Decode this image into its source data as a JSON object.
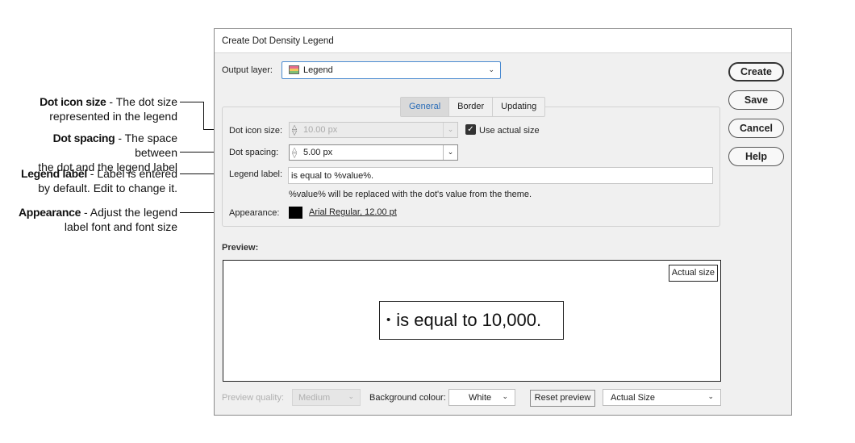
{
  "callouts": [
    {
      "bold": "Dot icon size",
      "text1": " - The dot size",
      "text2": "represented in the legend"
    },
    {
      "bold": "Dot spacing",
      "text1": " - The space between",
      "text2": "the dot and the legend label"
    },
    {
      "bold": "Legend label",
      "text1": " - Label is entered",
      "text2": "by default. Edit to change it."
    },
    {
      "bold": "Appearance",
      "text1": " - Adjust the legend",
      "text2": "label font and font size"
    }
  ],
  "dialog": {
    "title": "Create Dot Density Legend",
    "output_layer_label": "Output layer:",
    "output_layer_value": "Legend",
    "buttons": {
      "create": "Create",
      "save": "Save",
      "cancel": "Cancel",
      "help": "Help"
    },
    "tabs": [
      {
        "label": "General",
        "active": true
      },
      {
        "label": "Border",
        "active": false
      },
      {
        "label": "Updating",
        "active": false
      }
    ],
    "general": {
      "dot_icon_size_label": "Dot icon size:",
      "dot_icon_size_value": "10.00 px",
      "dot_icon_size_enabled": false,
      "use_actual_size_label": "Use actual size",
      "use_actual_size_checked": true,
      "dot_spacing_label": "Dot spacing:",
      "dot_spacing_value": "5.00 px",
      "legend_label_label": "Legend label:",
      "legend_label_value": "is equal to %value%.",
      "legend_hint": "%value% will be replaced with the dot's value from the theme.",
      "appearance_label": "Appearance:",
      "appearance_swatch_color": "#000000",
      "appearance_font": "Arial Regular, 12.00 pt"
    },
    "preview": {
      "title": "Preview:",
      "actual_size_badge": "Actual size",
      "sample_text": "is equal to 10,000.",
      "bullet": "•"
    },
    "footer": {
      "quality_label": "Preview quality:",
      "quality_value": "Medium",
      "background_label": "Background colour:",
      "background_value": "White",
      "reset_label": "Reset preview",
      "zoom_value": "Actual Size"
    },
    "colors": {
      "tab_active_text": "#2a6db8",
      "output_border": "#4a8ad0"
    }
  }
}
